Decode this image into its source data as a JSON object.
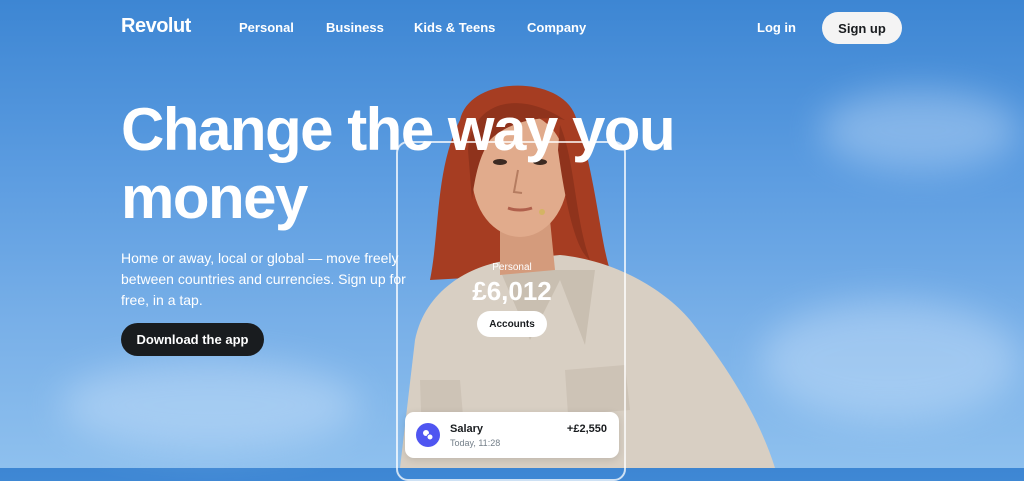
{
  "nav": {
    "logo": "Revolut",
    "items": [
      "Personal",
      "Business",
      "Kids & Teens",
      "Company"
    ],
    "login": "Log in",
    "signup": "Sign up"
  },
  "hero": {
    "title_line1": "Change the way you",
    "title_line2": "money",
    "subtitle": "Home or away, local or global — move freely between countries and currencies. Sign up for free, in a tap.",
    "cta": "Download the app"
  },
  "phone": {
    "account_label": "Personal",
    "balance": "£6,012",
    "accounts_button": "Accounts",
    "transaction": {
      "name": "Salary",
      "time": "Today, 11:28",
      "amount": "+£2,550",
      "icon": "coins-icon"
    }
  },
  "colors": {
    "sky": "#5a9be0",
    "dark_button": "#191c1f",
    "light_button": "#f4f4f4",
    "accent": "#4f55f1",
    "hair": "#a63d22",
    "jacket": "#d8cfc3"
  }
}
